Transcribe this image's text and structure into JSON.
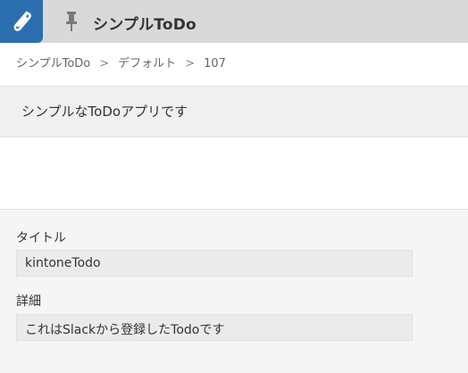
{
  "header": {
    "app_icon": "paperclip-icon",
    "pin_icon": "pin-icon",
    "title": "シンプルToDo"
  },
  "breadcrumb": {
    "items": [
      "シンプルToDo",
      "デフォルト",
      "107"
    ],
    "separator": ">"
  },
  "description": "シンプルなToDoアプリです",
  "record": {
    "fields": [
      {
        "label": "タイトル",
        "value": "kintoneTodo"
      },
      {
        "label": "詳細",
        "value": "これはSlackから登録したTodoです"
      }
    ]
  },
  "colors": {
    "header_bg": "#d9d9d9",
    "app_icon_bg": "#2b6fb0",
    "record_bg": "#f5f5f5",
    "field_bg": "#ebebeb"
  }
}
